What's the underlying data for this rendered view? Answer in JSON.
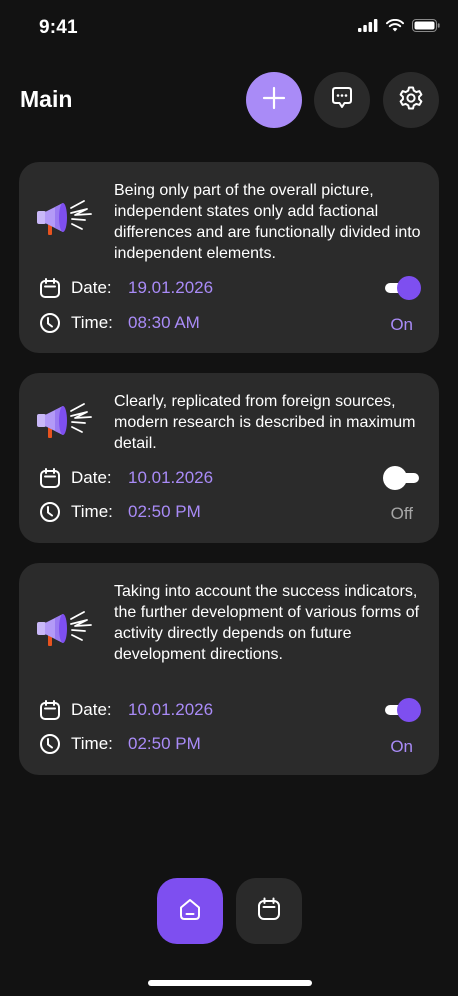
{
  "status_bar": {
    "time": "9:41"
  },
  "header": {
    "title": "Main"
  },
  "labels": {
    "date": "Date:",
    "time": "Time:"
  },
  "colors": {
    "accent": "#a98bf7",
    "accent_strong": "#7e4ff0",
    "card": "#2b2b2b",
    "background": "#121212"
  },
  "cards": [
    {
      "message": "Being only part of the overall picture, independent states only add factional differences and are functionally divided into independent elements.",
      "date": "19.01.2026",
      "time": "08:30 AM",
      "enabled": true,
      "state_label": "On"
    },
    {
      "message": "Clearly, replicated from foreign sources, modern research is described in maximum detail.",
      "date": "10.01.2026",
      "time": "02:50 PM",
      "enabled": false,
      "state_label": "Off"
    },
    {
      "message": "Taking into account the success indicators, the further development of various forms of activity directly depends on future development directions.",
      "date": "10.01.2026",
      "time": "02:50 PM",
      "enabled": true,
      "state_label": "On"
    }
  ],
  "icons": {
    "add": "plus-icon",
    "chat": "chat-bubble-icon",
    "settings": "gear-icon",
    "home": "home-icon",
    "calendar": "calendar-icon",
    "clock": "clock-icon",
    "megaphone": "megaphone-icon"
  }
}
